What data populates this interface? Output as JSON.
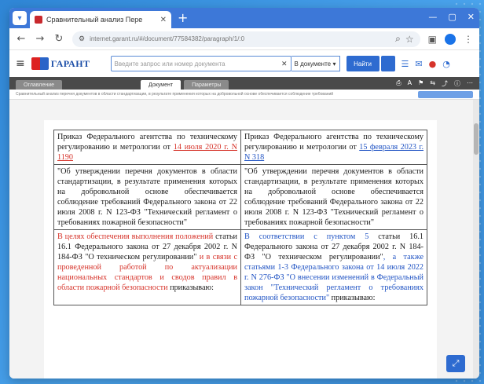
{
  "browser": {
    "tab_title": "Сравнительный анализ Пере",
    "tab_close": "✕",
    "new_tab": "+",
    "url": "internet.garant.ru/#/document/77584382/paragraph/1/:0",
    "controls": {
      "minimize": "—",
      "maximize": "▢",
      "close": "✕"
    }
  },
  "garant": {
    "logo_text": "ГАРАНТ",
    "search_placeholder": "Введите запрос или номер документа",
    "search_clear": "✕",
    "scope_select": "В документе",
    "find_button": "Найти"
  },
  "doc_toolbar": {
    "tabs": [
      "Оглавление",
      "Документ",
      "Параметры"
    ],
    "subtitle": "Сравнительный анализ перечня документов в области стандартизации, в результате применения которых на добровольной основе обеспечивается соблюдение требований"
  },
  "table": {
    "r1c1_pre": "Приказ Федерального агентства по техническому регулированию и метрологии от ",
    "r1c1_link": "14 июля 2020 г. N 1190",
    "r1c2_pre": "Приказ Федерального агентства по техническому регулированию и метрологии от ",
    "r1c2_link": "15 февраля 2023 г. N 318",
    "r2c1": "\"Об утверждении перечня документов в области стандартизации, в результате применения которых на добровольной основе обеспечивается соблюдение требований Федерального закона от 22 июля 2008 г. N 123-ФЗ \"Технический регламент о требованиях пожарной безопасности\"",
    "r2c2": "\"Об утверждении перечня документов в области стандартизации, в результате применения которых на добровольной основе обеспечивается соблюдение требований Федерального закона от 22 июля 2008 г. N 123-ФЗ \"Технический регламент о требованиях пожарной безопасности\"",
    "r3c1_red1": "В целях обеспечения выполнения положений",
    "r3c1_plain1": " статьи 16.1 Федерального закона от 27 декабря 2002 г. N 184-ФЗ \"О техническом регулировании\"",
    "r3c1_red2": " и в связи с проведенной работой по актуализации национальных стандартов и сводов правил в области пожарной безопасности",
    "r3c1_plain2": " приказываю:",
    "r3c2_blue1": "В соответствии с пунктом 5",
    "r3c2_plain1": " статьи 16.1 Федерального закона от 27 декабря 2002 г. N 184-ФЗ \"О техническом регулировании\"",
    "r3c2_blue2": ", а также статьями 1-3 Федерального закона от 14 июля 2022 г. N 276-ФЗ \"О внесении изменений в Федеральный закон \"Технический регламент о требованиях пожарной безопасности\"",
    "r3c2_plain2": " приказываю:"
  },
  "colors": {
    "accent": "#2e6bd0",
    "removed": "#d6332a",
    "added": "#2255c4"
  }
}
